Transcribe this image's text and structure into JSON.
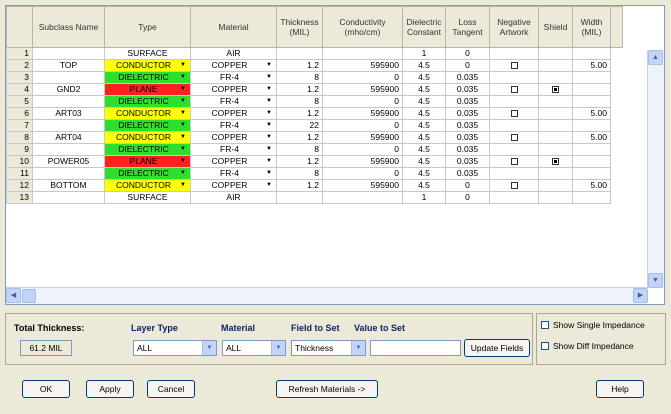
{
  "grid": {
    "headers": {
      "subclass": "Subclass Name",
      "type": "Type",
      "material": "Material",
      "thickness": "Thickness (MIL)",
      "conductivity": "Conductivity (mho/cm)",
      "dielectric": "Dielectric Constant",
      "loss": "Loss Tangent",
      "negart": "Negative Artwork",
      "shield": "Shield",
      "width": "Width (MIL)"
    },
    "rows": [
      {
        "n": "1",
        "name": "",
        "type": "SURFACE",
        "tstyle": "plain",
        "dd": false,
        "mat": "AIR",
        "mdd": false,
        "thk": "",
        "cond": "",
        "diel": "1",
        "loss": "0",
        "neg": "none",
        "shield": "none",
        "width": ""
      },
      {
        "n": "2",
        "name": "TOP",
        "type": "CONDUCTOR",
        "tstyle": "cond",
        "dd": true,
        "mat": "COPPER",
        "mdd": true,
        "thk": "1.2",
        "cond": "595900",
        "diel": "4.5",
        "loss": "0",
        "neg": "off",
        "shield": "none",
        "width": "5.00"
      },
      {
        "n": "3",
        "name": "",
        "type": "DIELECTRIC",
        "tstyle": "diel",
        "dd": true,
        "mat": "FR-4",
        "mdd": true,
        "thk": "8",
        "cond": "0",
        "diel": "4.5",
        "loss": "0.035",
        "neg": "none",
        "shield": "none",
        "width": ""
      },
      {
        "n": "4",
        "name": "GND2",
        "type": "PLANE",
        "tstyle": "plane",
        "dd": true,
        "mat": "COPPER",
        "mdd": true,
        "thk": "1.2",
        "cond": "595900",
        "diel": "4.5",
        "loss": "0.035",
        "neg": "off",
        "shield": "on",
        "width": ""
      },
      {
        "n": "5",
        "name": "",
        "type": "DIELECTRIC",
        "tstyle": "diel",
        "dd": true,
        "mat": "FR-4",
        "mdd": true,
        "thk": "8",
        "cond": "0",
        "diel": "4.5",
        "loss": "0.035",
        "neg": "none",
        "shield": "none",
        "width": ""
      },
      {
        "n": "6",
        "name": "ART03",
        "type": "CONDUCTOR",
        "tstyle": "cond",
        "dd": true,
        "mat": "COPPER",
        "mdd": true,
        "thk": "1.2",
        "cond": "595900",
        "diel": "4.5",
        "loss": "0.035",
        "neg": "off",
        "shield": "none",
        "width": "5.00"
      },
      {
        "n": "7",
        "name": "",
        "type": "DIELECTRIC",
        "tstyle": "diel",
        "dd": true,
        "mat": "FR-4",
        "mdd": true,
        "thk": "22",
        "cond": "0",
        "diel": "4.5",
        "loss": "0.035",
        "neg": "none",
        "shield": "none",
        "width": ""
      },
      {
        "n": "8",
        "name": "ART04",
        "type": "CONDUCTOR",
        "tstyle": "cond",
        "dd": true,
        "mat": "COPPER",
        "mdd": true,
        "thk": "1.2",
        "cond": "595900",
        "diel": "4.5",
        "loss": "0.035",
        "neg": "off",
        "shield": "none",
        "width": "5.00"
      },
      {
        "n": "9",
        "name": "",
        "type": "DIELECTRIC",
        "tstyle": "diel",
        "dd": true,
        "mat": "FR-4",
        "mdd": true,
        "thk": "8",
        "cond": "0",
        "diel": "4.5",
        "loss": "0.035",
        "neg": "none",
        "shield": "none",
        "width": ""
      },
      {
        "n": "10",
        "name": "POWER05",
        "type": "PLANE",
        "tstyle": "plane",
        "dd": true,
        "mat": "COPPER",
        "mdd": true,
        "thk": "1.2",
        "cond": "595900",
        "diel": "4.5",
        "loss": "0.035",
        "neg": "off",
        "shield": "on",
        "width": ""
      },
      {
        "n": "11",
        "name": "",
        "type": "DIELECTRIC",
        "tstyle": "diel",
        "dd": true,
        "mat": "FR-4",
        "mdd": true,
        "thk": "8",
        "cond": "0",
        "diel": "4.5",
        "loss": "0.035",
        "neg": "none",
        "shield": "none",
        "width": ""
      },
      {
        "n": "12",
        "name": "BOTTOM",
        "type": "CONDUCTOR",
        "tstyle": "cond",
        "dd": true,
        "mat": "COPPER",
        "mdd": true,
        "thk": "1.2",
        "cond": "595900",
        "diel": "4.5",
        "loss": "0",
        "neg": "off",
        "shield": "none",
        "width": "5.00"
      },
      {
        "n": "13",
        "name": "",
        "type": "SURFACE",
        "tstyle": "plain",
        "dd": false,
        "mat": "AIR",
        "mdd": false,
        "thk": "",
        "cond": "",
        "diel": "1",
        "loss": "0",
        "neg": "none",
        "shield": "none",
        "width": ""
      }
    ]
  },
  "controls": {
    "total_thickness_label": "Total Thickness:",
    "total_thickness_value": "61.2 MIL",
    "layer_type_label": "Layer Type",
    "layer_type_value": "ALL",
    "material_label": "Material",
    "material_value": "ALL",
    "field_label": "Field to Set",
    "field_value": "Thickness",
    "value_label": "Value to Set",
    "value_value": "",
    "update_button": "Update Fields"
  },
  "options": {
    "single_impedance": "Show Single Impedance",
    "diff_impedance": "Show Diff Impedance"
  },
  "buttons": {
    "ok": "OK",
    "apply": "Apply",
    "cancel": "Cancel",
    "refresh": "Refresh Materials ->",
    "help": "Help"
  }
}
